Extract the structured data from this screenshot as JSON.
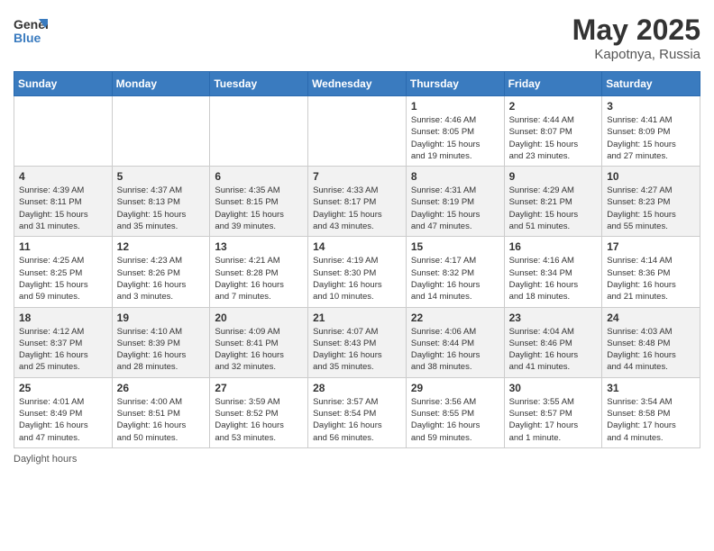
{
  "header": {
    "logo_line1": "General",
    "logo_line2": "Blue",
    "title_month": "May 2025",
    "title_location": "Kapotnya, Russia"
  },
  "days_of_week": [
    "Sunday",
    "Monday",
    "Tuesday",
    "Wednesday",
    "Thursday",
    "Friday",
    "Saturday"
  ],
  "weeks": [
    [
      {
        "num": "",
        "info": ""
      },
      {
        "num": "",
        "info": ""
      },
      {
        "num": "",
        "info": ""
      },
      {
        "num": "",
        "info": ""
      },
      {
        "num": "1",
        "info": "Sunrise: 4:46 AM\nSunset: 8:05 PM\nDaylight: 15 hours\nand 19 minutes."
      },
      {
        "num": "2",
        "info": "Sunrise: 4:44 AM\nSunset: 8:07 PM\nDaylight: 15 hours\nand 23 minutes."
      },
      {
        "num": "3",
        "info": "Sunrise: 4:41 AM\nSunset: 8:09 PM\nDaylight: 15 hours\nand 27 minutes."
      }
    ],
    [
      {
        "num": "4",
        "info": "Sunrise: 4:39 AM\nSunset: 8:11 PM\nDaylight: 15 hours\nand 31 minutes."
      },
      {
        "num": "5",
        "info": "Sunrise: 4:37 AM\nSunset: 8:13 PM\nDaylight: 15 hours\nand 35 minutes."
      },
      {
        "num": "6",
        "info": "Sunrise: 4:35 AM\nSunset: 8:15 PM\nDaylight: 15 hours\nand 39 minutes."
      },
      {
        "num": "7",
        "info": "Sunrise: 4:33 AM\nSunset: 8:17 PM\nDaylight: 15 hours\nand 43 minutes."
      },
      {
        "num": "8",
        "info": "Sunrise: 4:31 AM\nSunset: 8:19 PM\nDaylight: 15 hours\nand 47 minutes."
      },
      {
        "num": "9",
        "info": "Sunrise: 4:29 AM\nSunset: 8:21 PM\nDaylight: 15 hours\nand 51 minutes."
      },
      {
        "num": "10",
        "info": "Sunrise: 4:27 AM\nSunset: 8:23 PM\nDaylight: 15 hours\nand 55 minutes."
      }
    ],
    [
      {
        "num": "11",
        "info": "Sunrise: 4:25 AM\nSunset: 8:25 PM\nDaylight: 15 hours\nand 59 minutes."
      },
      {
        "num": "12",
        "info": "Sunrise: 4:23 AM\nSunset: 8:26 PM\nDaylight: 16 hours\nand 3 minutes."
      },
      {
        "num": "13",
        "info": "Sunrise: 4:21 AM\nSunset: 8:28 PM\nDaylight: 16 hours\nand 7 minutes."
      },
      {
        "num": "14",
        "info": "Sunrise: 4:19 AM\nSunset: 8:30 PM\nDaylight: 16 hours\nand 10 minutes."
      },
      {
        "num": "15",
        "info": "Sunrise: 4:17 AM\nSunset: 8:32 PM\nDaylight: 16 hours\nand 14 minutes."
      },
      {
        "num": "16",
        "info": "Sunrise: 4:16 AM\nSunset: 8:34 PM\nDaylight: 16 hours\nand 18 minutes."
      },
      {
        "num": "17",
        "info": "Sunrise: 4:14 AM\nSunset: 8:36 PM\nDaylight: 16 hours\nand 21 minutes."
      }
    ],
    [
      {
        "num": "18",
        "info": "Sunrise: 4:12 AM\nSunset: 8:37 PM\nDaylight: 16 hours\nand 25 minutes."
      },
      {
        "num": "19",
        "info": "Sunrise: 4:10 AM\nSunset: 8:39 PM\nDaylight: 16 hours\nand 28 minutes."
      },
      {
        "num": "20",
        "info": "Sunrise: 4:09 AM\nSunset: 8:41 PM\nDaylight: 16 hours\nand 32 minutes."
      },
      {
        "num": "21",
        "info": "Sunrise: 4:07 AM\nSunset: 8:43 PM\nDaylight: 16 hours\nand 35 minutes."
      },
      {
        "num": "22",
        "info": "Sunrise: 4:06 AM\nSunset: 8:44 PM\nDaylight: 16 hours\nand 38 minutes."
      },
      {
        "num": "23",
        "info": "Sunrise: 4:04 AM\nSunset: 8:46 PM\nDaylight: 16 hours\nand 41 minutes."
      },
      {
        "num": "24",
        "info": "Sunrise: 4:03 AM\nSunset: 8:48 PM\nDaylight: 16 hours\nand 44 minutes."
      }
    ],
    [
      {
        "num": "25",
        "info": "Sunrise: 4:01 AM\nSunset: 8:49 PM\nDaylight: 16 hours\nand 47 minutes."
      },
      {
        "num": "26",
        "info": "Sunrise: 4:00 AM\nSunset: 8:51 PM\nDaylight: 16 hours\nand 50 minutes."
      },
      {
        "num": "27",
        "info": "Sunrise: 3:59 AM\nSunset: 8:52 PM\nDaylight: 16 hours\nand 53 minutes."
      },
      {
        "num": "28",
        "info": "Sunrise: 3:57 AM\nSunset: 8:54 PM\nDaylight: 16 hours\nand 56 minutes."
      },
      {
        "num": "29",
        "info": "Sunrise: 3:56 AM\nSunset: 8:55 PM\nDaylight: 16 hours\nand 59 minutes."
      },
      {
        "num": "30",
        "info": "Sunrise: 3:55 AM\nSunset: 8:57 PM\nDaylight: 17 hours\nand 1 minute."
      },
      {
        "num": "31",
        "info": "Sunrise: 3:54 AM\nSunset: 8:58 PM\nDaylight: 17 hours\nand 4 minutes."
      }
    ]
  ],
  "footer": {
    "daylight_label": "Daylight hours"
  }
}
